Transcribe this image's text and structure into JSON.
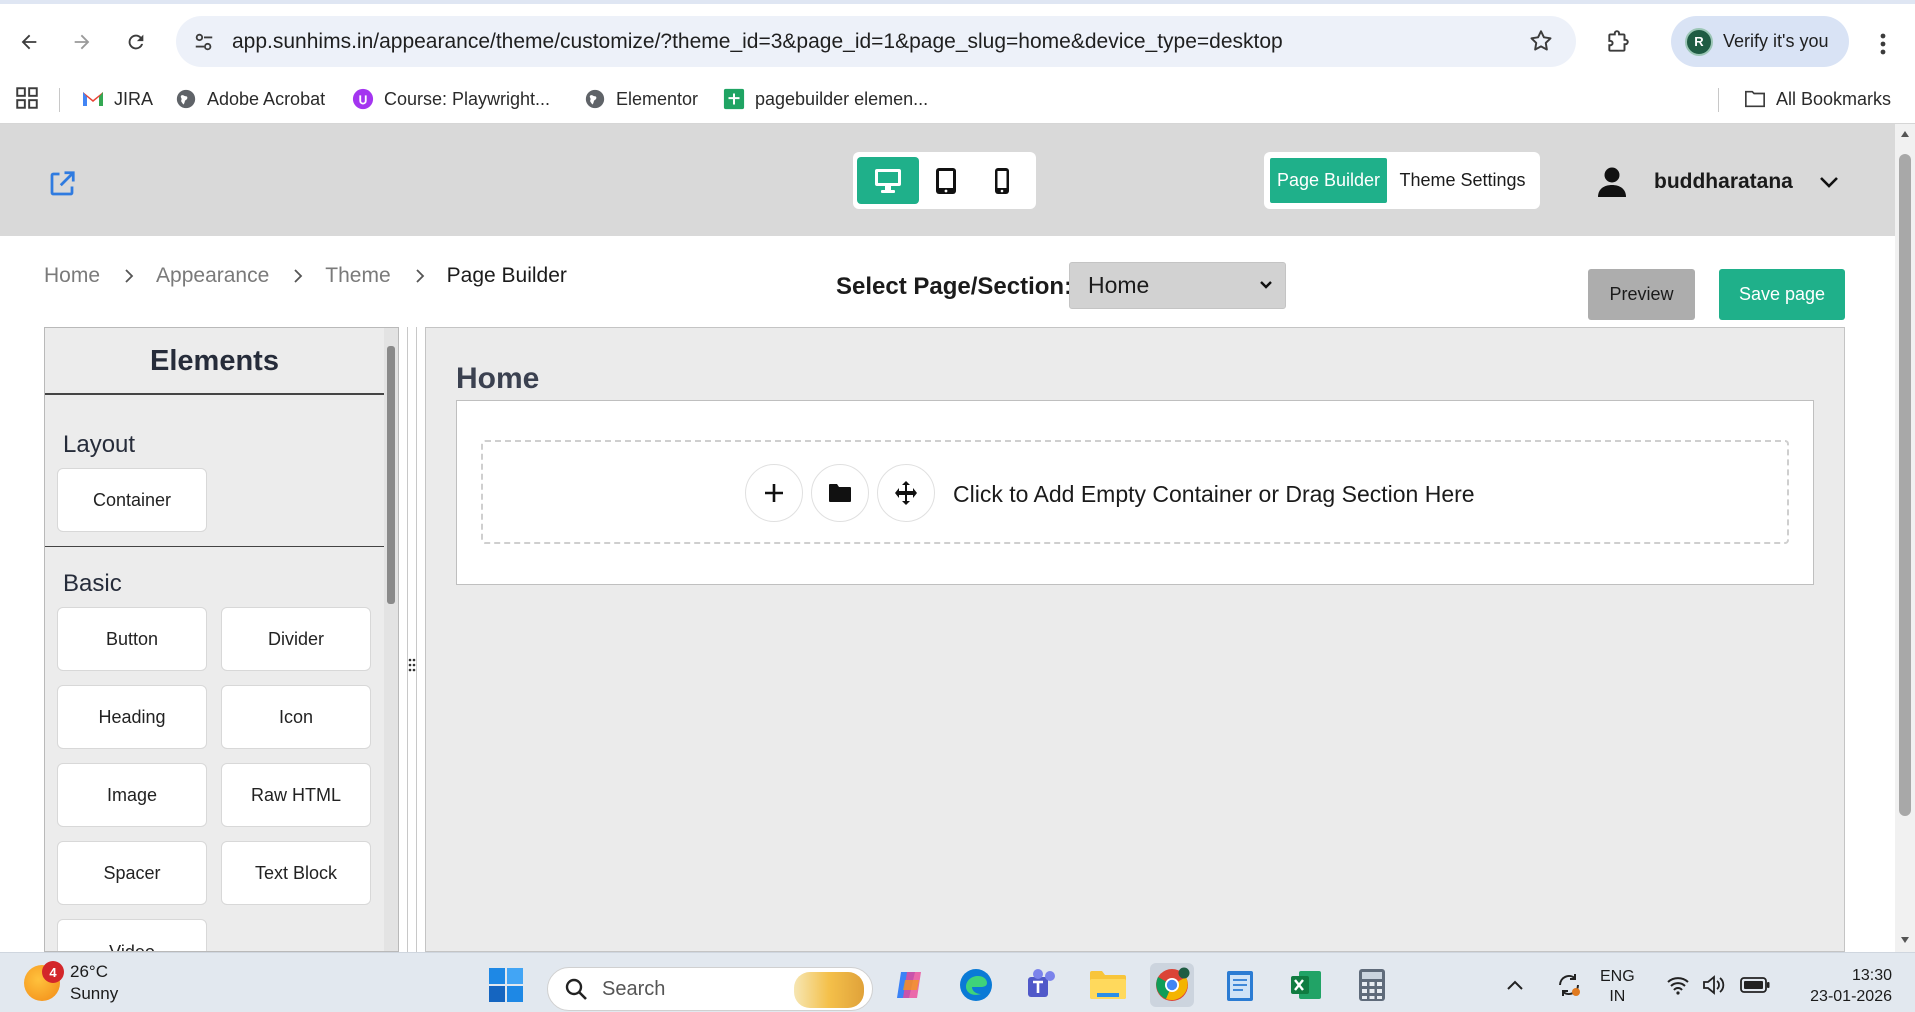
{
  "browser": {
    "url": "app.sunhims.in/appearance/theme/customize/?theme_id=3&page_id=1&page_slug=home&device_type=desktop",
    "profile_label": "Verify it's you",
    "profile_initial": "R"
  },
  "bookmarks": [
    {
      "label": "JIRA"
    },
    {
      "label": "Adobe Acrobat"
    },
    {
      "label": "Course: Playwright..."
    },
    {
      "label": "Elementor"
    },
    {
      "label": "pagebuilder elemen..."
    }
  ],
  "all_bookmarks_label": "All Bookmarks",
  "header": {
    "device_active": "desktop",
    "mode_tabs": {
      "page_builder": "Page Builder",
      "theme_settings": "Theme Settings"
    },
    "username": "buddharatana"
  },
  "breadcrumb": {
    "home": "Home",
    "appearance": "Appearance",
    "theme": "Theme",
    "current": "Page Builder"
  },
  "toolbar": {
    "select_label": "Select Page/Section:",
    "select_value": "Home",
    "preview_label": "Preview",
    "save_label": "Save page"
  },
  "elements_panel": {
    "title": "Elements",
    "layout_title": "Layout",
    "layout_items": [
      "Container"
    ],
    "basic_title": "Basic",
    "basic_items": [
      "Button",
      "Divider",
      "Heading",
      "Icon",
      "Image",
      "Raw HTML",
      "Spacer",
      "Text Block",
      "Video"
    ]
  },
  "canvas": {
    "page_title": "Home",
    "drop_text": "Click to Add Empty Container or Drag Section Here"
  },
  "taskbar": {
    "weather_badge": "4",
    "temperature": "26°C",
    "condition": "Sunny",
    "search_placeholder": "Search",
    "lang_line1": "ENG",
    "lang_line2": "IN",
    "time": "13:30",
    "date": "23-01-2026"
  },
  "colors": {
    "accent": "#1fb08a",
    "header_bg": "#d9d9d9",
    "canvas_bg": "#ebebeb"
  }
}
